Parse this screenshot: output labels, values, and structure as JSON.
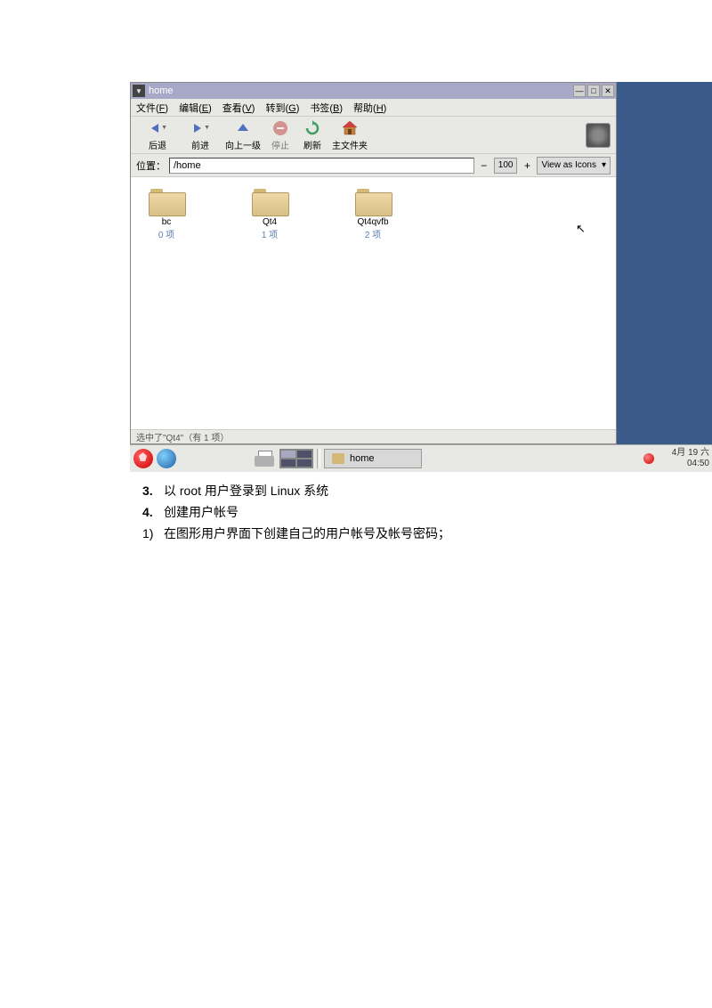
{
  "window": {
    "title": "home",
    "menu": {
      "file": "文件(F)",
      "edit": "编辑(E)",
      "view": "查看(V)",
      "go": "转到(G)",
      "bookmarks": "书签(B)",
      "help": "帮助(H)"
    },
    "toolbar": {
      "back": "后退",
      "forward": "前进",
      "up": "向上一级",
      "stop": "停止",
      "reload": "刷新",
      "home": "主文件夹"
    },
    "location": {
      "label": "位置：",
      "value": "/home",
      "zoom": "100",
      "view_mode": "View as Icons"
    },
    "folders": [
      {
        "name": "bc",
        "count": "0 项"
      },
      {
        "name": "Qt4",
        "count": "1 项"
      },
      {
        "name": "Qt4qvfb",
        "count": "2 项"
      }
    ],
    "status": "选中了\"Qt4\"（有 1 项）"
  },
  "taskbar": {
    "task_label": "home",
    "date": "4月 19 六",
    "time": "04:50"
  },
  "document": {
    "line3": "以 root 用户登录到 Linux 系统",
    "line4": "创建用户帐号",
    "line5": "在图形用户界面下创建自己的用户帐号及帐号密码；"
  }
}
